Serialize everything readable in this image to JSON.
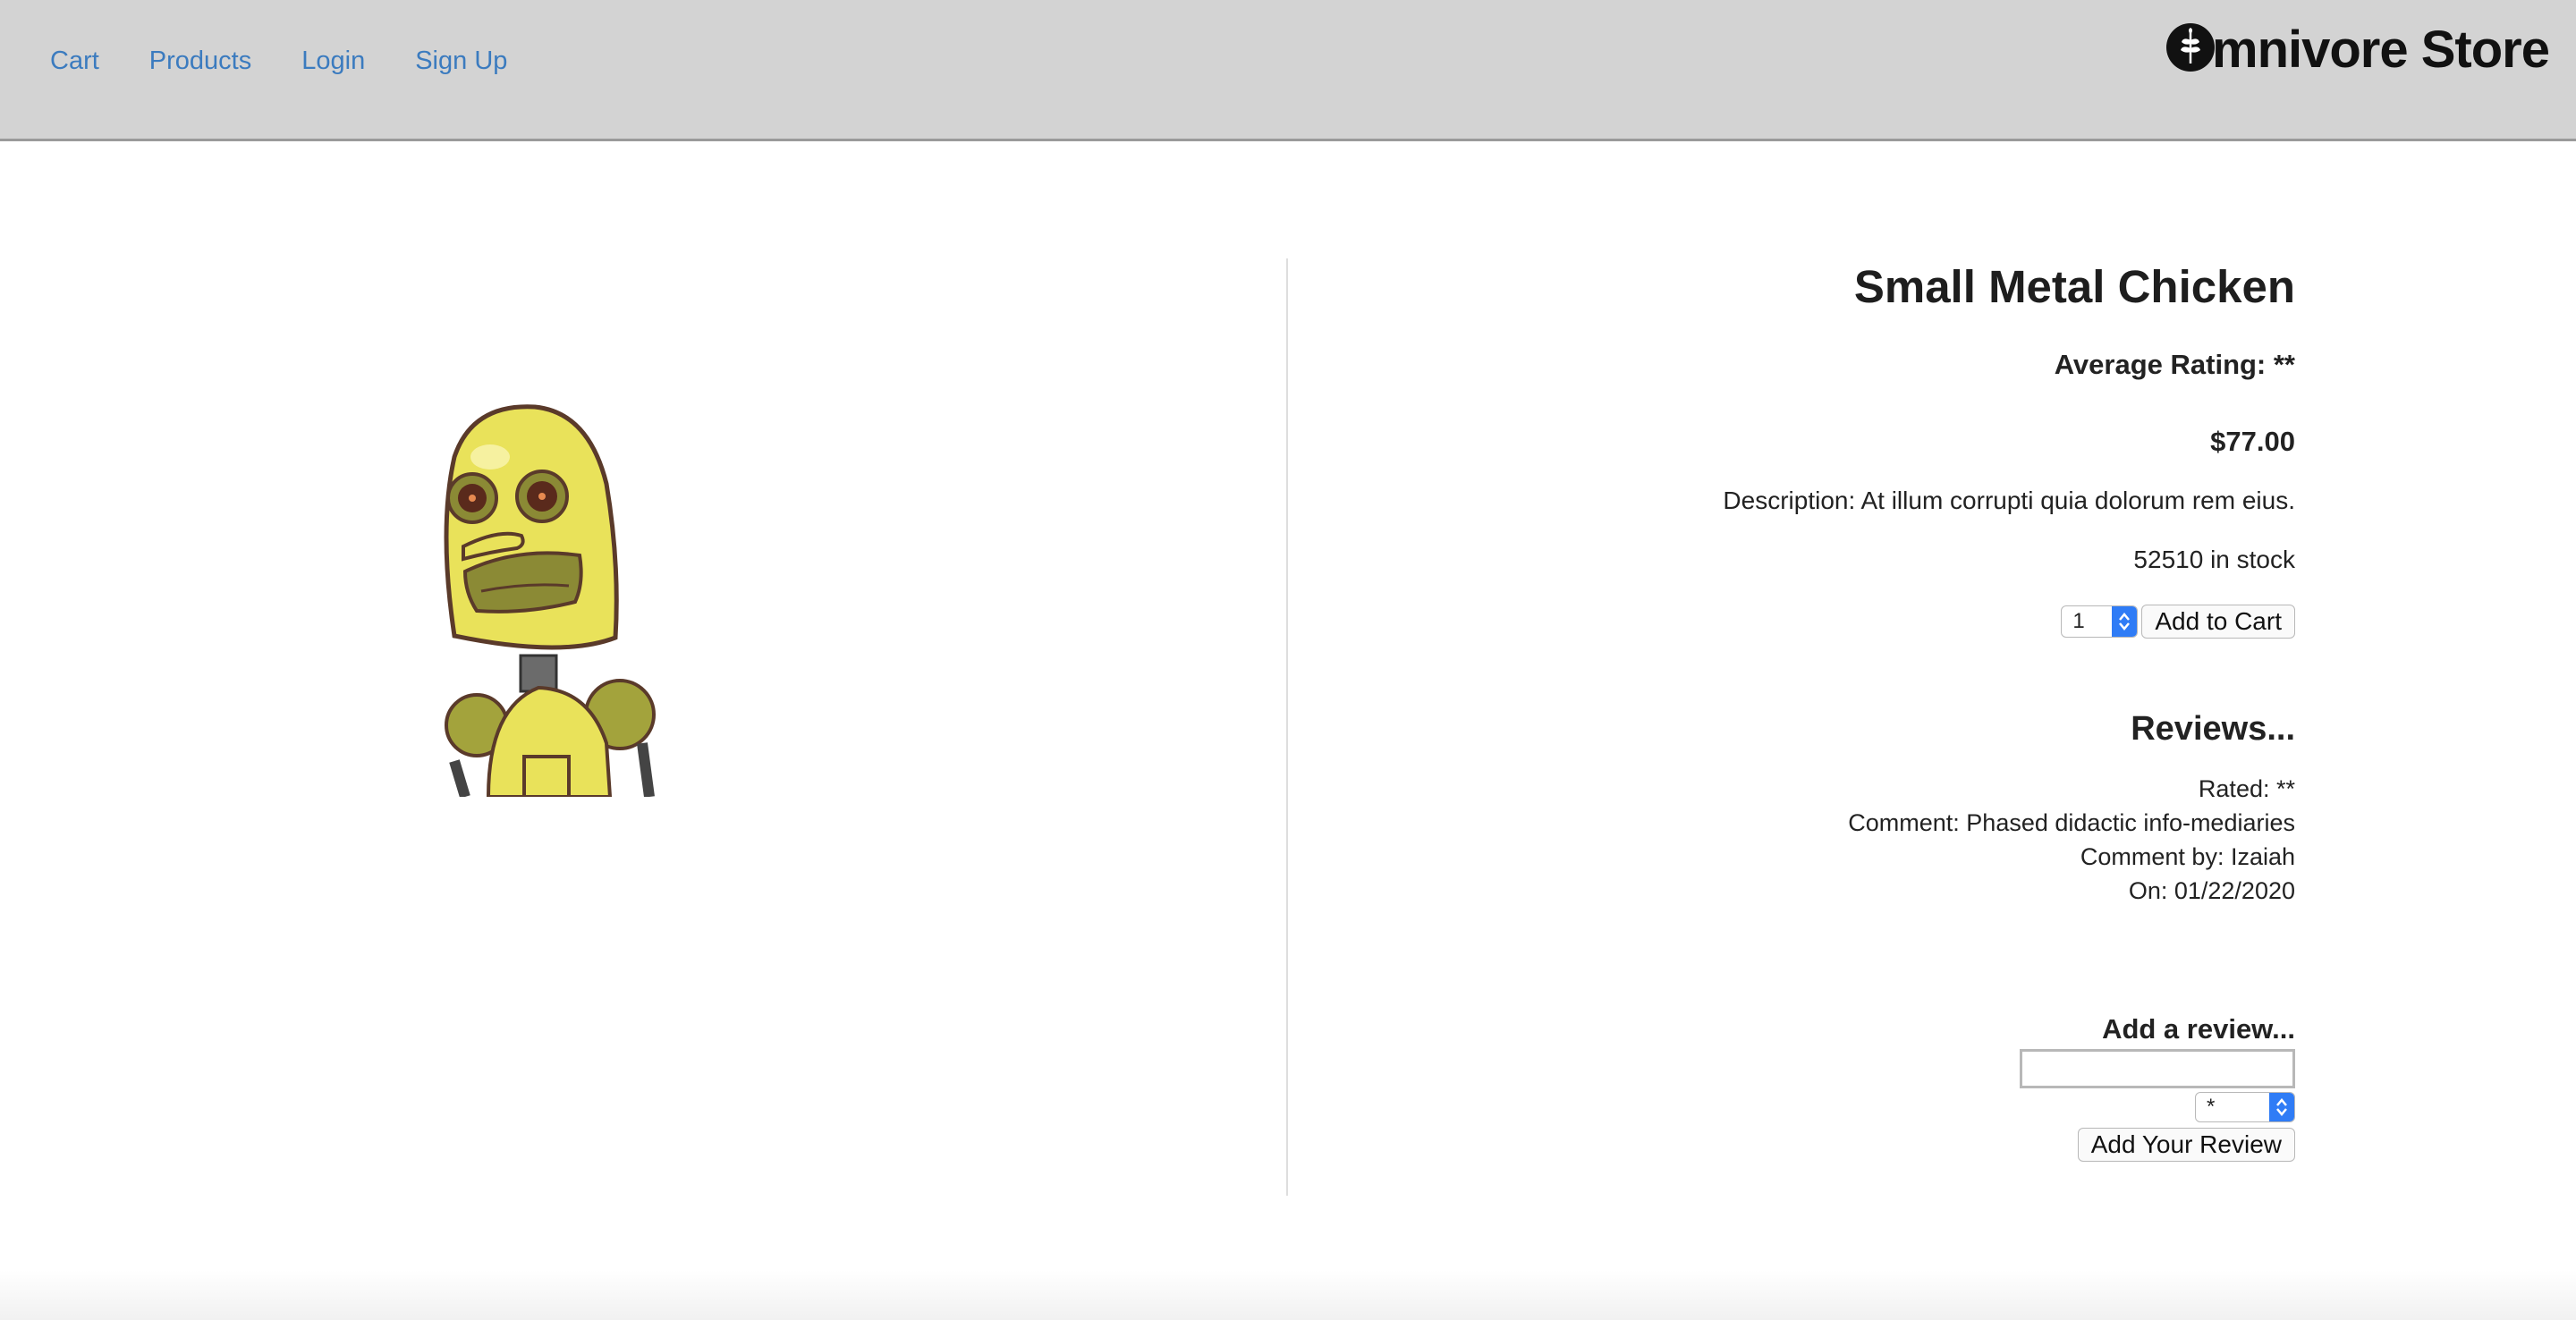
{
  "nav": {
    "links": [
      "Cart",
      "Products",
      "Login",
      "Sign Up"
    ],
    "brand": "mnivore Store",
    "link_color": "#3b7bbf",
    "background": "#d3d3d3"
  },
  "product": {
    "image_icon": "robot-mascot-image",
    "title": "Small Metal Chicken",
    "average_rating": "Average Rating: **",
    "price": "$77.00",
    "description": "Description: At illum corrupti quia dolorum rem eius.",
    "stock": "52510 in stock",
    "quantity_selected": "1",
    "add_to_cart_label": "Add to Cart"
  },
  "reviews": {
    "heading": "Reviews...",
    "items": [
      {
        "rated": "Rated: **",
        "comment": "Comment: Phased didactic info-mediaries",
        "by": "Comment by: Izaiah",
        "on": "On: 01/22/2020"
      }
    ]
  },
  "add_review": {
    "heading": "Add a review...",
    "comment_value": "",
    "rating_selected": "*",
    "submit_label": "Add Your Review"
  }
}
